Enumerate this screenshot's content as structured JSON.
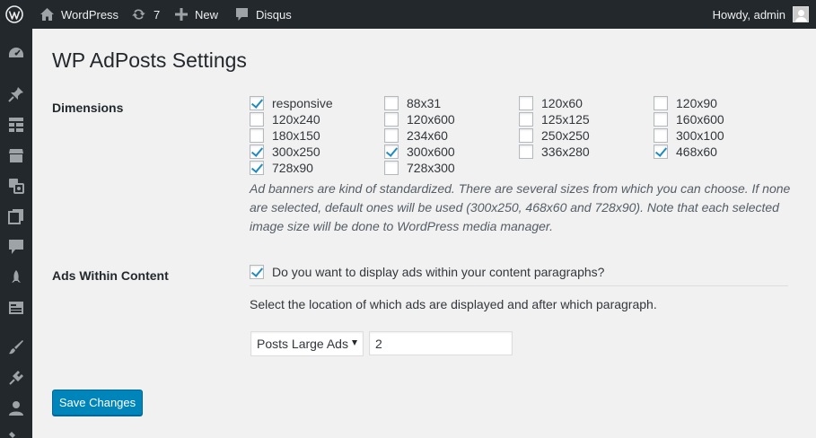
{
  "admin_bar": {
    "site_name": "WordPress",
    "updates_count": "7",
    "new_label": "New",
    "disqus_label": "Disqus",
    "howdy": "Howdy, admin"
  },
  "page": {
    "title": "WP AdPosts Settings"
  },
  "dimensions": {
    "label": "Dimensions",
    "options": [
      {
        "label": "responsive",
        "checked": true
      },
      {
        "label": "88x31",
        "checked": false
      },
      {
        "label": "120x60",
        "checked": false
      },
      {
        "label": "120x90",
        "checked": false
      },
      {
        "label": "120x240",
        "checked": false
      },
      {
        "label": "120x600",
        "checked": false
      },
      {
        "label": "125x125",
        "checked": false
      },
      {
        "label": "160x600",
        "checked": false
      },
      {
        "label": "180x150",
        "checked": false
      },
      {
        "label": "234x60",
        "checked": false
      },
      {
        "label": "250x250",
        "checked": false
      },
      {
        "label": "300x100",
        "checked": false
      },
      {
        "label": "300x250",
        "checked": true
      },
      {
        "label": "300x600",
        "checked": true
      },
      {
        "label": "336x280",
        "checked": false
      },
      {
        "label": "468x60",
        "checked": true
      },
      {
        "label": "728x90",
        "checked": true
      },
      {
        "label": "728x300",
        "checked": false
      }
    ],
    "description": "Ad banners are kind of standardized. There are several sizes from which you can choose. If none are selected, default ones will be used (300x250, 468x60 and 728x90). Note that each selected image size will be done to WordPress media manager."
  },
  "ads_within_content": {
    "label": "Ads Within Content",
    "checkbox_label": "Do you want to display ads within your content paragraphs?",
    "checked": true,
    "location_text": "Select the location of which ads are displayed and after which paragraph.",
    "select_value": "Posts Large Ads",
    "paragraph_value": "2"
  },
  "actions": {
    "save_label": "Save Changes"
  },
  "colors": {
    "admin_bar_bg": "#23282d",
    "accent": "#0085ba",
    "check": "#1e8cbe"
  }
}
